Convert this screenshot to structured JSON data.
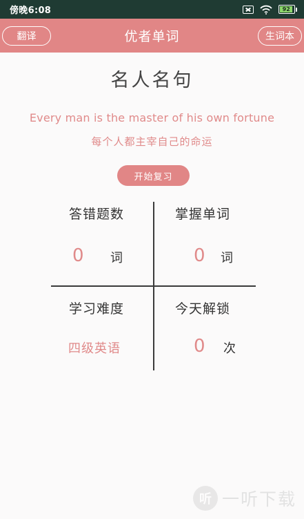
{
  "status_bar": {
    "time": "傍晚6:08",
    "battery": "92",
    "battery_level": 0.92
  },
  "header": {
    "title": "优者单词",
    "left_button": "翻译",
    "right_button": "生词本"
  },
  "quote": {
    "heading": "名人名句",
    "english": "Every man is the master of his own  fortune",
    "chinese": "每个人都主宰自己的命运"
  },
  "review_button": "开始复习",
  "stats": {
    "wrong": {
      "label": "答错题数",
      "value": "0",
      "unit": "词"
    },
    "mastered": {
      "label": "掌握单词",
      "value": "0",
      "unit": "词"
    },
    "difficulty": {
      "label": "学习难度",
      "value": "四级英语"
    },
    "unlock": {
      "label": "今天解锁",
      "value": "0",
      "unit": "次"
    }
  },
  "watermark": {
    "text": "一听下载",
    "logo_glyph": "听"
  },
  "colors": {
    "accent": "#e18686",
    "status_bar": "#1f3b33",
    "battery": "#8dd86b"
  }
}
